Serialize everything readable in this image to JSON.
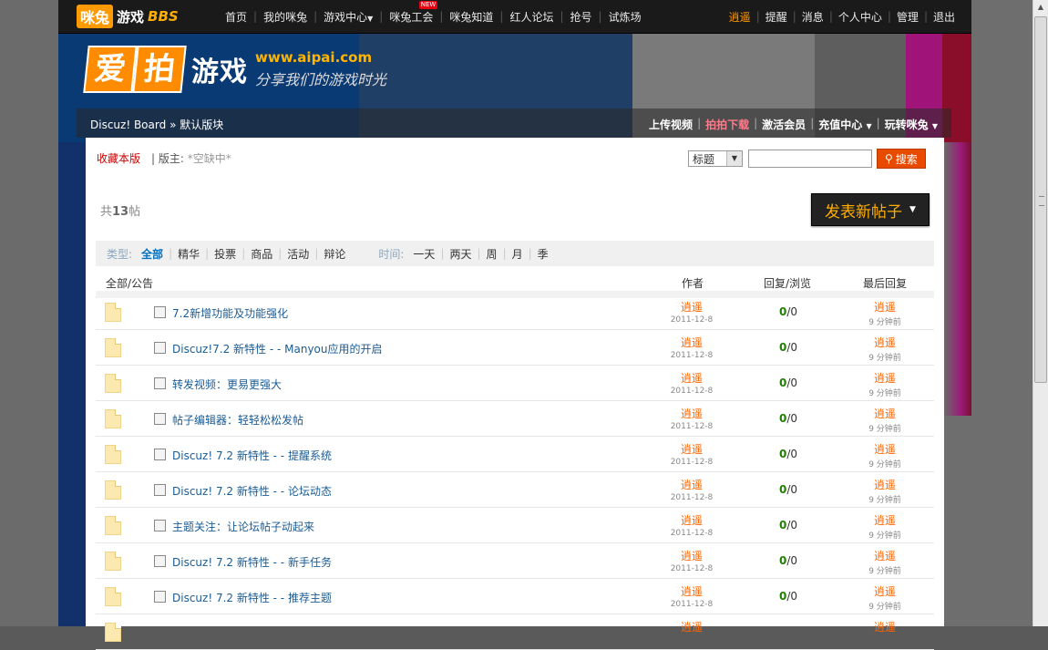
{
  "topnav": {
    "logo_main": "咪兔",
    "logo_game": "游戏",
    "logo_bbs": "BBS",
    "links": [
      "首页",
      "我的咪兔",
      "游戏中心",
      "咪兔工会",
      "咪兔知道",
      "红人论坛",
      "抢号",
      "试炼场"
    ],
    "new_badge": "NEW",
    "right_links": [
      "逍遥",
      "提醒",
      "消息",
      "个人中心",
      "管理",
      "退出"
    ]
  },
  "brand": {
    "mark1": "爱",
    "mark2": "拍",
    "game": "游戏",
    "url": "www.aipai.com",
    "slogan": "分享我们的游戏时光"
  },
  "breadcrumb": {
    "board": "Discuz! Board",
    "sep": "»",
    "section": "默认版块",
    "right_links": [
      "上传视频",
      "拍拍下载",
      "激活会员",
      "充值中心",
      "玩转咪兔"
    ]
  },
  "forum": {
    "favorite": "收藏本版",
    "moderator_label": "版主:",
    "moderator_value": "*空缺中*",
    "search_select": "标题",
    "search_button": "搜索",
    "count_prefix": "共",
    "count_value": "13",
    "count_suffix": "帖",
    "new_post_button": "发表新帖子"
  },
  "filter": {
    "type_label": "类型:",
    "types": [
      "全部",
      "精华",
      "投票",
      "商品",
      "活动",
      "辩论"
    ],
    "time_label": "时间:",
    "times": [
      "一天",
      "两天",
      "周",
      "月",
      "季"
    ]
  },
  "table": {
    "headers": [
      "全部/公告",
      "作者",
      "回复/浏览",
      "最后回复"
    ],
    "rows": [
      {
        "title": "7.2新增功能及功能强化",
        "author": "逍遥",
        "date": "2011-12-8",
        "replies": "0",
        "views": "0",
        "last_user": "逍遥",
        "last_time": "9 分钟前"
      },
      {
        "title": "Discuz!7.2 新特性 - - Manyou应用的开启",
        "author": "逍遥",
        "date": "2011-12-8",
        "replies": "0",
        "views": "0",
        "last_user": "逍遥",
        "last_time": "9 分钟前"
      },
      {
        "title": "转发视频：更易更强大",
        "author": "逍遥",
        "date": "2011-12-8",
        "replies": "0",
        "views": "0",
        "last_user": "逍遥",
        "last_time": "9 分钟前"
      },
      {
        "title": "帖子编辑器：轻轻松松发帖",
        "author": "逍遥",
        "date": "2011-12-8",
        "replies": "0",
        "views": "0",
        "last_user": "逍遥",
        "last_time": "9 分钟前"
      },
      {
        "title": "Discuz! 7.2 新特性 - - 提醒系统",
        "author": "逍遥",
        "date": "2011-12-8",
        "replies": "0",
        "views": "0",
        "last_user": "逍遥",
        "last_time": "9 分钟前"
      },
      {
        "title": "Discuz! 7.2 新特性 - - 论坛动态",
        "author": "逍遥",
        "date": "2011-12-8",
        "replies": "0",
        "views": "0",
        "last_user": "逍遥",
        "last_time": "9 分钟前"
      },
      {
        "title": "主题关注：让论坛帖子动起来",
        "author": "逍遥",
        "date": "2011-12-8",
        "replies": "0",
        "views": "0",
        "last_user": "逍遥",
        "last_time": "9 分钟前"
      },
      {
        "title": "Discuz! 7.2 新特性 - - 新手任务",
        "author": "逍遥",
        "date": "2011-12-8",
        "replies": "0",
        "views": "0",
        "last_user": "逍遥",
        "last_time": "9 分钟前"
      },
      {
        "title": "Discuz! 7.2 新特性 - - 推荐主题",
        "author": "逍遥",
        "date": "2011-12-8",
        "replies": "0",
        "views": "0",
        "last_user": "逍遥",
        "last_time": "9 分钟前"
      },
      {
        "title": "",
        "author": "逍遥",
        "date": "",
        "replies": "",
        "views": "",
        "last_user": "逍遥",
        "last_time": ""
      }
    ]
  },
  "colors": {
    "accent": "#ff6600",
    "link": "#1a5c96",
    "reply_count": "#208000",
    "topbar": "#1a1a1a"
  }
}
